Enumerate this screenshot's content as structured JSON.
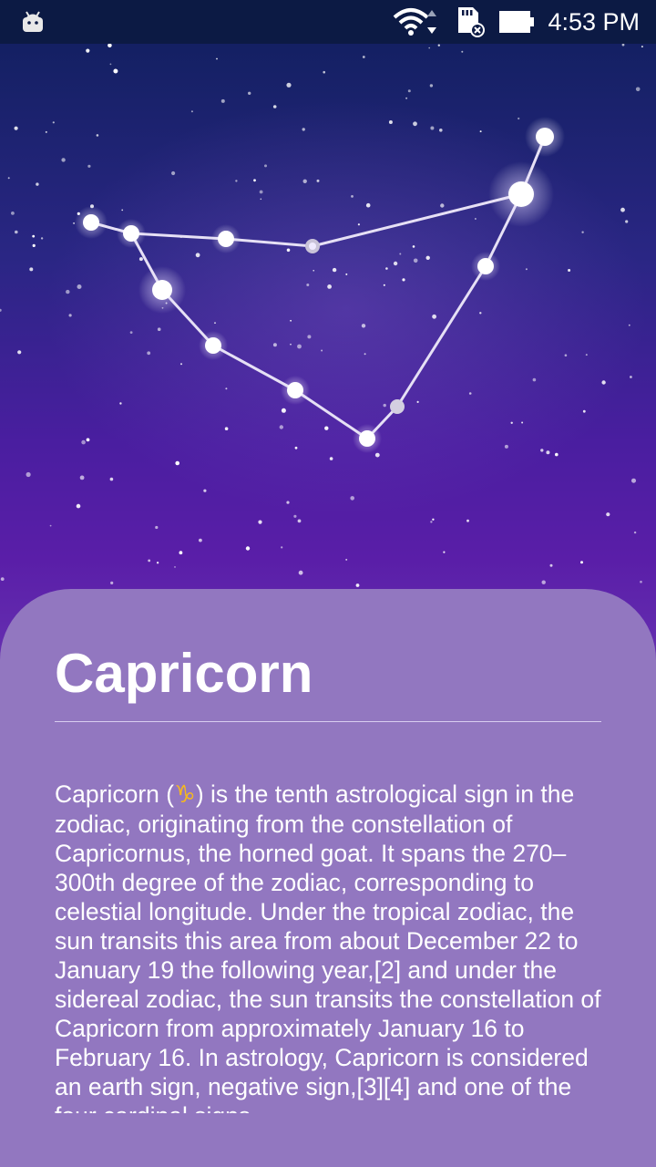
{
  "status_bar": {
    "time": "4:53 PM",
    "icons": [
      "android-icon",
      "wifi-icon",
      "sd-card-icon",
      "battery-icon"
    ]
  },
  "sign": {
    "title": "Capricorn",
    "description_before_symbol": "Capricorn (",
    "symbol": "♑",
    "description_after_symbol": ") is the tenth astrological sign in the zodiac, originating from the constellation of Capricornus, the horned goat. It spans the 270–300th degree of the zodiac, corresponding to celestial longitude. Under the tropical zodiac, the sun transits this area from about December 22 to January 19 the following year,[2] and under the sidereal zodiac, the sun transits the constellation of Capricorn from approximately January 16 to February 16. In astrology, Capricorn is considered an earth sign, negative sign,[3][4] and one of the four cardinal signs."
  },
  "colors": {
    "card": "#9277c0",
    "symbol": "#f5b81e",
    "statusbar": "#0c1a44"
  }
}
